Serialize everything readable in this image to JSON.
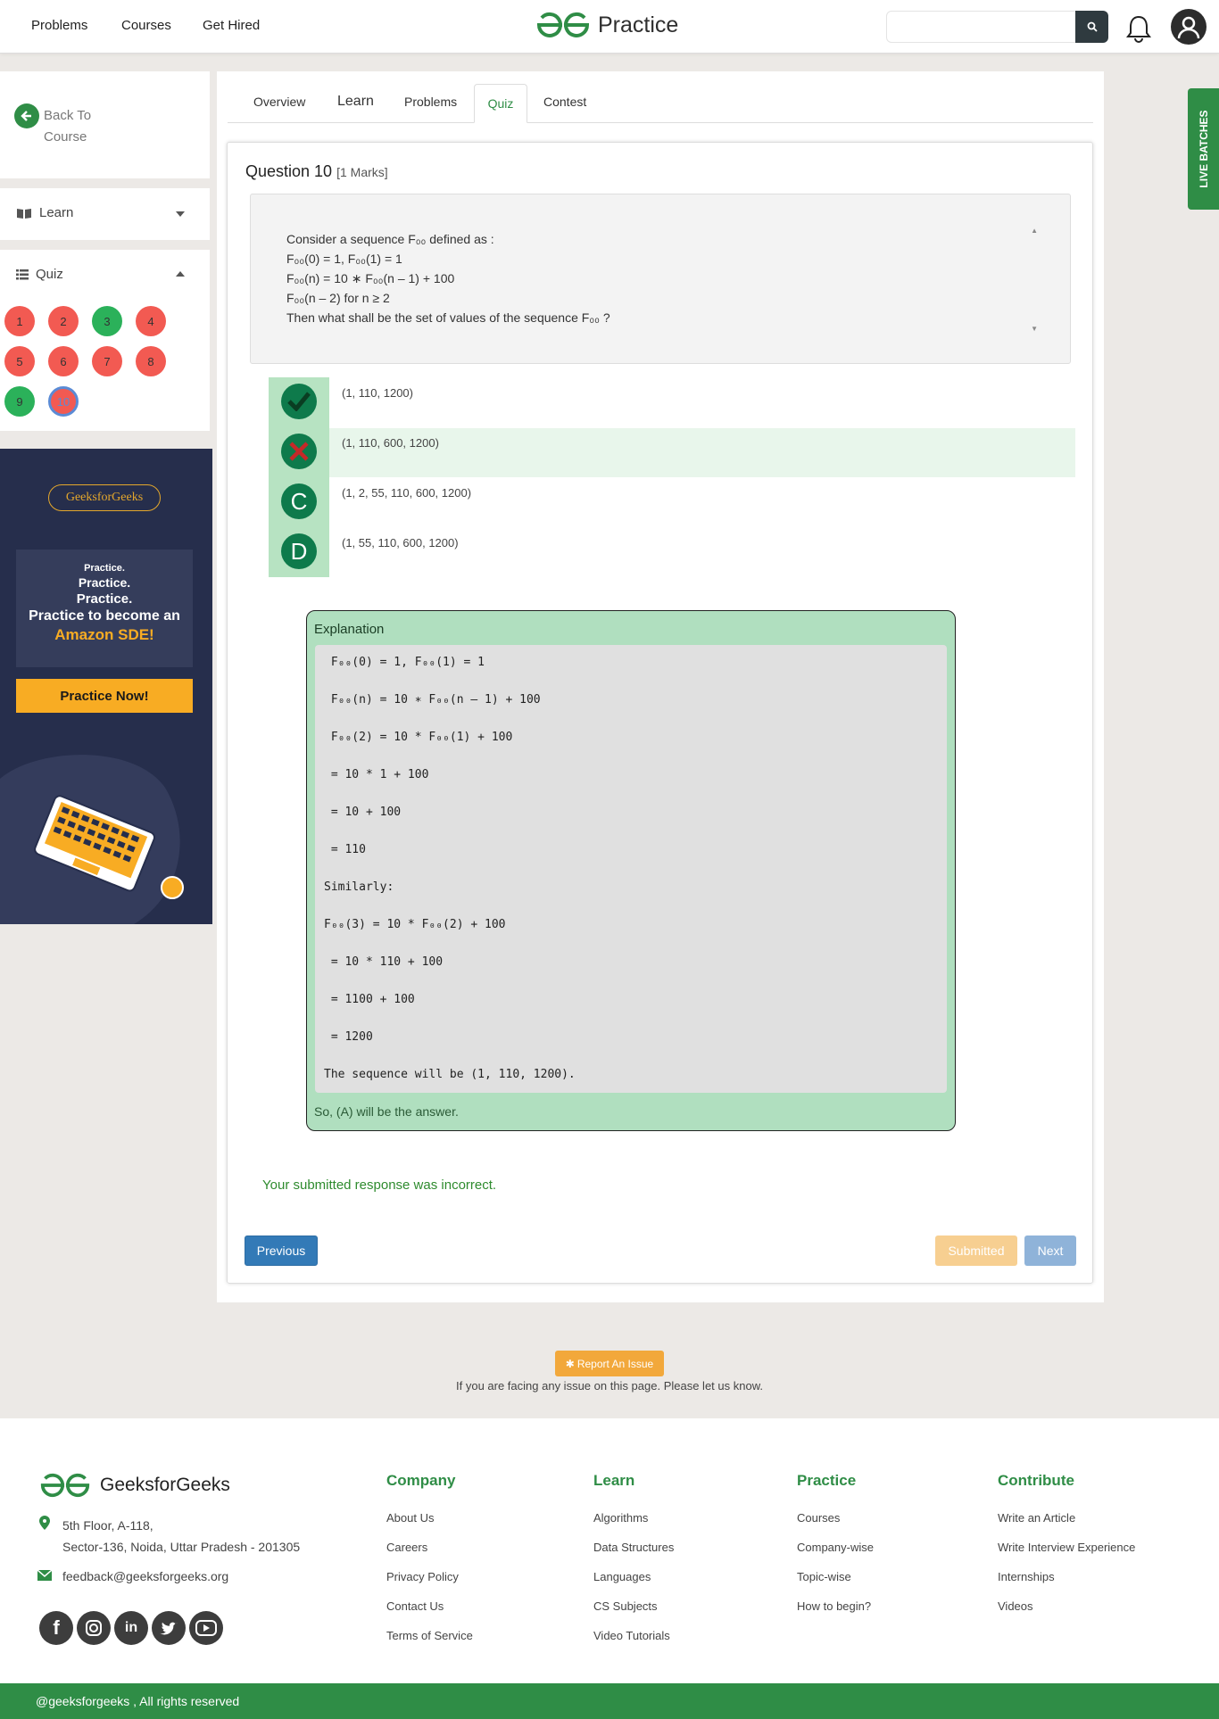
{
  "navbar": {
    "links": [
      "Problems",
      "Courses",
      "Get Hired"
    ],
    "logo_text": "Practice",
    "search_placeholder": ""
  },
  "sidebar": {
    "back_label": "Back To Course",
    "learn_label": "Learn",
    "quiz_label": "Quiz",
    "questions": [
      {
        "n": "1",
        "status": "incorrect"
      },
      {
        "n": "2",
        "status": "incorrect"
      },
      {
        "n": "3",
        "status": "correct"
      },
      {
        "n": "4",
        "status": "incorrect"
      },
      {
        "n": "5",
        "status": "incorrect"
      },
      {
        "n": "6",
        "status": "incorrect"
      },
      {
        "n": "7",
        "status": "incorrect"
      },
      {
        "n": "8",
        "status": "incorrect"
      },
      {
        "n": "9",
        "status": "correct"
      },
      {
        "n": "10",
        "status": "current"
      }
    ]
  },
  "promo": {
    "logo": "GeeksforGeeks",
    "line1": "Practice.",
    "line2": "Practice.",
    "line3": "Practice.",
    "line4": "Practice to become an",
    "line5": "Amazon SDE!",
    "button": "Practice Now!"
  },
  "tabs": [
    "Overview",
    "Learn",
    "Problems",
    "Quiz",
    "Contest"
  ],
  "active_tab": "Quiz",
  "question": {
    "title": "Question 10",
    "marks": "[1 Marks]",
    "lines": [
      "Consider a sequence F₀₀ defined as :",
      "F₀₀(0) = 1, F₀₀(1) = 1",
      "F₀₀(n) = 10 ∗ F₀₀(n – 1) + 100",
      "F₀₀(n – 2) for n ≥ 2",
      "Then what shall be the set of values of the sequence F₀₀ ?"
    ]
  },
  "options": [
    {
      "badge": "✓",
      "text": "(1, 110, 1200)",
      "state": "correct"
    },
    {
      "badge": "✗",
      "text": "(1, 110, 600, 1200)",
      "state": "selected-wrong"
    },
    {
      "badge": "C",
      "text": "(1, 2, 55, 110, 600, 1200)",
      "state": "none"
    },
    {
      "badge": "D",
      "text": "(1, 55, 110, 600, 1200)",
      "state": "none"
    }
  ],
  "explanation": {
    "title": "Explanation",
    "code": [
      " F₀₀(0) = 1, F₀₀(1) = 1",
      " F₀₀(n) = 10 ∗ F₀₀(n – 1) + 100",
      " F₀₀(2) = 10 * F₀₀(1) + 100",
      " = 10 * 1 + 100",
      " = 10 + 100",
      " = 110",
      "Similarly:",
      "F₀₀(3) = 10 * F₀₀(2) + 100",
      " = 10 * 110 + 100",
      " = 1100 + 100",
      " = 1200",
      "The sequence will be (1, 110, 1200)."
    ],
    "footer": "So, (A) will be the answer."
  },
  "response_message": "Your submitted response was incorrect.",
  "buttons": {
    "previous": "Previous",
    "submitted": "Submitted",
    "next": "Next"
  },
  "live_batches": "LIVE BATCHES",
  "report": {
    "button": "Report An Issue",
    "note": "If you are facing any issue on this page. Please let us know."
  },
  "footer": {
    "brand": "GeeksforGeeks",
    "address_line1": "5th Floor, A-118,",
    "address_line2": "Sector-136, Noida, Uttar Pradesh - 201305",
    "email": "feedback@geeksforgeeks.org",
    "columns": [
      {
        "title": "Company",
        "links": [
          "About Us",
          "Careers",
          "Privacy Policy",
          "Contact Us",
          "Terms of Service"
        ]
      },
      {
        "title": "Learn",
        "links": [
          "Algorithms",
          "Data Structures",
          "Languages",
          "CS Subjects",
          "Video Tutorials"
        ]
      },
      {
        "title": "Practice",
        "links": [
          "Courses",
          "Company-wise",
          "Topic-wise",
          "How to begin?"
        ]
      },
      {
        "title": "Contribute",
        "links": [
          "Write an Article",
          "Write Interview Experience",
          "Internships",
          "Videos"
        ]
      }
    ],
    "social": [
      "facebook-icon",
      "instagram-icon",
      "linkedin-icon",
      "twitter-icon",
      "youtube-icon"
    ],
    "copyright": "@geeksforgeeks , All rights reserved"
  },
  "colors": {
    "brand_green": "#2f8d46",
    "wrong_red": "#f25a52",
    "correct_green": "#2bb15a"
  }
}
